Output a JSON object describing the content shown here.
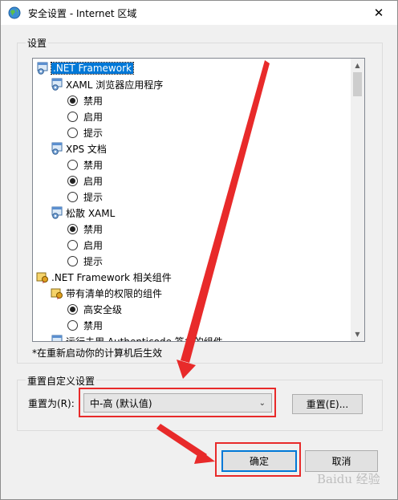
{
  "window": {
    "title": "安全设置 - Internet 区域",
    "close_glyph": "✕"
  },
  "settings": {
    "label": "设置",
    "tree": [
      {
        "kind": "category",
        "icon": "gear-window-icon",
        "label": ".NET Framework",
        "selected": true
      },
      {
        "kind": "subcategory",
        "icon": "gear-window-icon",
        "label": "XAML 浏览器应用程序"
      },
      {
        "kind": "option",
        "label": "禁用",
        "checked": true
      },
      {
        "kind": "option",
        "label": "启用",
        "checked": false
      },
      {
        "kind": "option",
        "label": "提示",
        "checked": false
      },
      {
        "kind": "subcategory",
        "icon": "gear-window-icon",
        "label": "XPS 文档"
      },
      {
        "kind": "option",
        "label": "禁用",
        "checked": false
      },
      {
        "kind": "option",
        "label": "启用",
        "checked": true
      },
      {
        "kind": "option",
        "label": "提示",
        "checked": false
      },
      {
        "kind": "subcategory",
        "icon": "gear-window-icon",
        "label": "松散 XAML"
      },
      {
        "kind": "option",
        "label": "禁用",
        "checked": true
      },
      {
        "kind": "option",
        "label": "启用",
        "checked": false
      },
      {
        "kind": "option",
        "label": "提示",
        "checked": false
      },
      {
        "kind": "category",
        "icon": "cert-icon",
        "label": ".NET Framework 相关组件",
        "selected": false
      },
      {
        "kind": "subcategory",
        "icon": "cert-icon",
        "label": "带有清单的权限的组件"
      },
      {
        "kind": "option",
        "label": "高安全级",
        "checked": true
      },
      {
        "kind": "option",
        "label": "禁用",
        "checked": false
      },
      {
        "kind": "subcategory",
        "icon": "gear-window-icon",
        "label": "运行未用 Authenticode 签名的组件"
      }
    ],
    "restart_note": "*在重新启动你的计算机后生效"
  },
  "reset": {
    "group_label": "重置自定义设置",
    "reset_to_label": "重置为(R):",
    "level_value": "中-高 (默认值)",
    "reset_button": "重置(E)..."
  },
  "buttons": {
    "ok": "确定",
    "cancel": "取消"
  },
  "watermark": "Baidu 经验",
  "colors": {
    "selection": "#0078d7",
    "annotation_red": "#e82a2a"
  }
}
